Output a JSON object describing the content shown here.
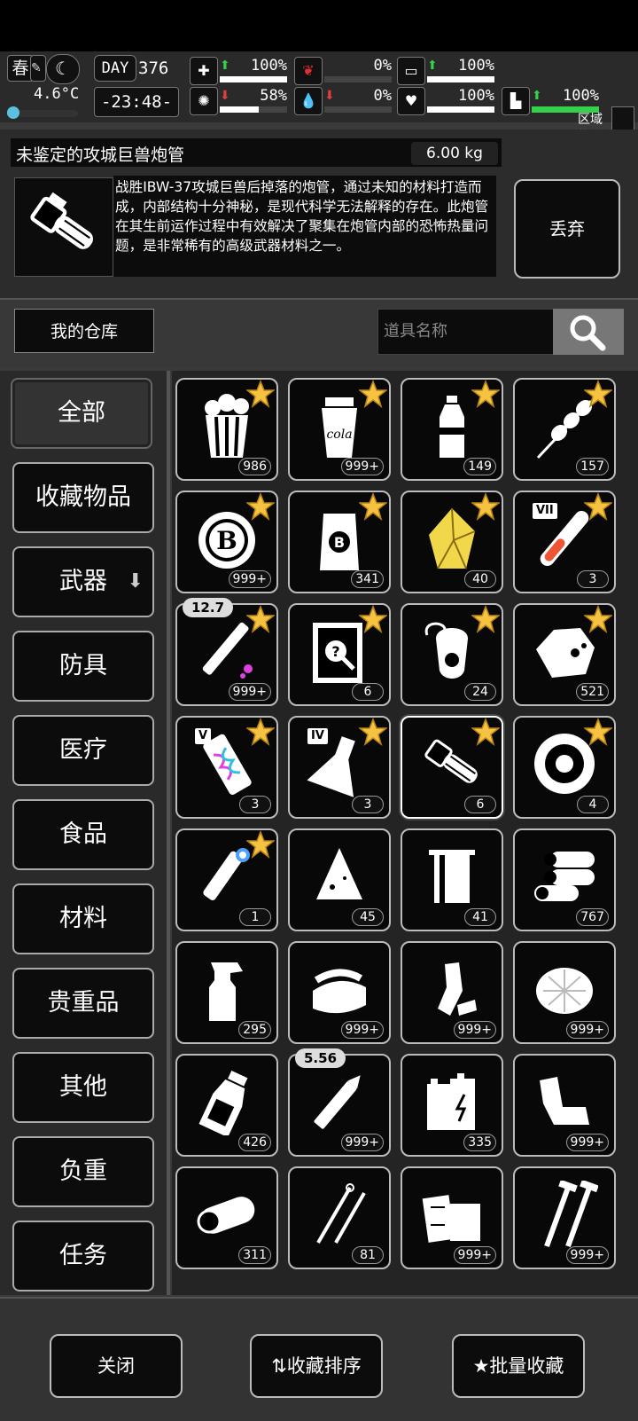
{
  "status": {
    "season": "春",
    "temperature": "4.6°C",
    "temperature_fraction": 0.15,
    "day_label": "DAY",
    "day_number": "376",
    "time": "-23:48-",
    "stats": [
      {
        "name": "health",
        "icon": "medkit-icon",
        "direction": "up",
        "value": "100%",
        "fraction": 1.0
      },
      {
        "name": "hunger",
        "icon": "stomach-icon",
        "direction": "none",
        "value": "0%",
        "fraction": 0.0
      },
      {
        "name": "sickness",
        "icon": "pill-icon",
        "direction": "up",
        "value": "100%",
        "fraction": 1.0
      },
      {
        "name": "sanity",
        "icon": "brain-icon",
        "direction": "down",
        "value": "58%",
        "fraction": 0.58
      },
      {
        "name": "thirst",
        "icon": "blood-drop-icon",
        "direction": "down",
        "value": "0%",
        "fraction": 0.0
      },
      {
        "name": "mood",
        "icon": "heart-icon",
        "direction": "none",
        "value": "100%",
        "fraction": 1.0
      },
      {
        "name": "stamina",
        "icon": "boot-icon",
        "direction": "up",
        "value": "100%",
        "fraction": 1.0
      }
    ],
    "zone_label": "区域热度",
    "accent_green": "#35d04c",
    "accent_red": "#e04040"
  },
  "item": {
    "name": "未鉴定的攻城巨兽炮管",
    "weight": "6.00 kg",
    "description": "战胜IBW-37攻城巨兽后掉落的炮管，通过未知的材料打造而成，内部结构十分神秘，是现代科学无法解释的存在。此炮管在其生前运作过程中有效解决了聚集在炮管内部的恐怖热量问题，是非常稀有的高级武器材料之一。",
    "discard_label": "丢弃"
  },
  "warehouse": {
    "title": "我的仓库",
    "search_placeholder": "道具名称"
  },
  "categories": [
    {
      "label": "全部",
      "active": true
    },
    {
      "label": "收藏物品"
    },
    {
      "label": "武器",
      "has_dropdown": true
    },
    {
      "label": "防具"
    },
    {
      "label": "医疗"
    },
    {
      "label": "食品"
    },
    {
      "label": "材料"
    },
    {
      "label": "贵重品"
    },
    {
      "label": "其他"
    },
    {
      "label": "负重"
    },
    {
      "label": "任务"
    }
  ],
  "items": [
    {
      "icon": "popcorn-icon",
      "count": "986",
      "starred": true
    },
    {
      "icon": "cola-cup-icon",
      "count": "999+",
      "starred": true,
      "label": "cola"
    },
    {
      "icon": "water-bottle-icon",
      "count": "149",
      "starred": true
    },
    {
      "icon": "skewer-icon",
      "count": "157",
      "starred": true
    },
    {
      "icon": "chip-coin-icon",
      "count": "999+",
      "starred": true
    },
    {
      "icon": "coin-bag-icon",
      "count": "341",
      "starred": true
    },
    {
      "icon": "gold-crystal-icon",
      "count": "40",
      "starred": true
    },
    {
      "icon": "test-tube-icon",
      "count": "3",
      "starred": true,
      "roman": "VII"
    },
    {
      "icon": "syringe-icon",
      "count": "999+",
      "starred": true,
      "tag": "12.7"
    },
    {
      "icon": "manual-icon",
      "count": "6",
      "starred": true
    },
    {
      "icon": "gas-mask-icon",
      "count": "24",
      "starred": true
    },
    {
      "icon": "ore-rock-icon",
      "count": "521",
      "starred": true
    },
    {
      "icon": "dna-vial-icon",
      "count": "3",
      "starred": true,
      "roman": "V"
    },
    {
      "icon": "flask-icon",
      "count": "3",
      "starred": true,
      "roman": "IV"
    },
    {
      "icon": "cannon-barrel-icon",
      "count": "6",
      "starred": true,
      "selected": true
    },
    {
      "icon": "gear-wheel-icon",
      "count": "4",
      "starred": true
    },
    {
      "icon": "robot-arm-icon",
      "count": "1",
      "starred": true
    },
    {
      "icon": "cloth-scrap-icon",
      "count": "45",
      "starred": false
    },
    {
      "icon": "towel-icon",
      "count": "41",
      "starred": false
    },
    {
      "icon": "logs-icon",
      "count": "767",
      "starred": false
    },
    {
      "icon": "spray-bottle-icon",
      "count": "295",
      "starred": false
    },
    {
      "icon": "folded-cloth-icon",
      "count": "999+",
      "starred": false
    },
    {
      "icon": "crushed-bottle-icon",
      "count": "999+",
      "starred": false
    },
    {
      "icon": "fiber-icon",
      "count": "999+",
      "starred": false
    },
    {
      "icon": "glass-bottle-icon",
      "count": "426",
      "starred": false
    },
    {
      "icon": "bullet-icon",
      "count": "999+",
      "starred": false,
      "tag": "5.56"
    },
    {
      "icon": "battery-icon",
      "count": "335",
      "starred": false
    },
    {
      "icon": "scrap-metal-icon",
      "count": "999+",
      "starred": false
    },
    {
      "icon": "wood-log-icon",
      "count": "311",
      "starred": false
    },
    {
      "icon": "hook-tools-icon",
      "count": "81",
      "starred": false
    },
    {
      "icon": "planks-icon",
      "count": "999+",
      "starred": false
    },
    {
      "icon": "screws-icon",
      "count": "999+",
      "starred": false
    }
  ],
  "footer": {
    "close_label": "关闭",
    "sort_label": "收藏排序",
    "batch_label": "批量收藏"
  }
}
